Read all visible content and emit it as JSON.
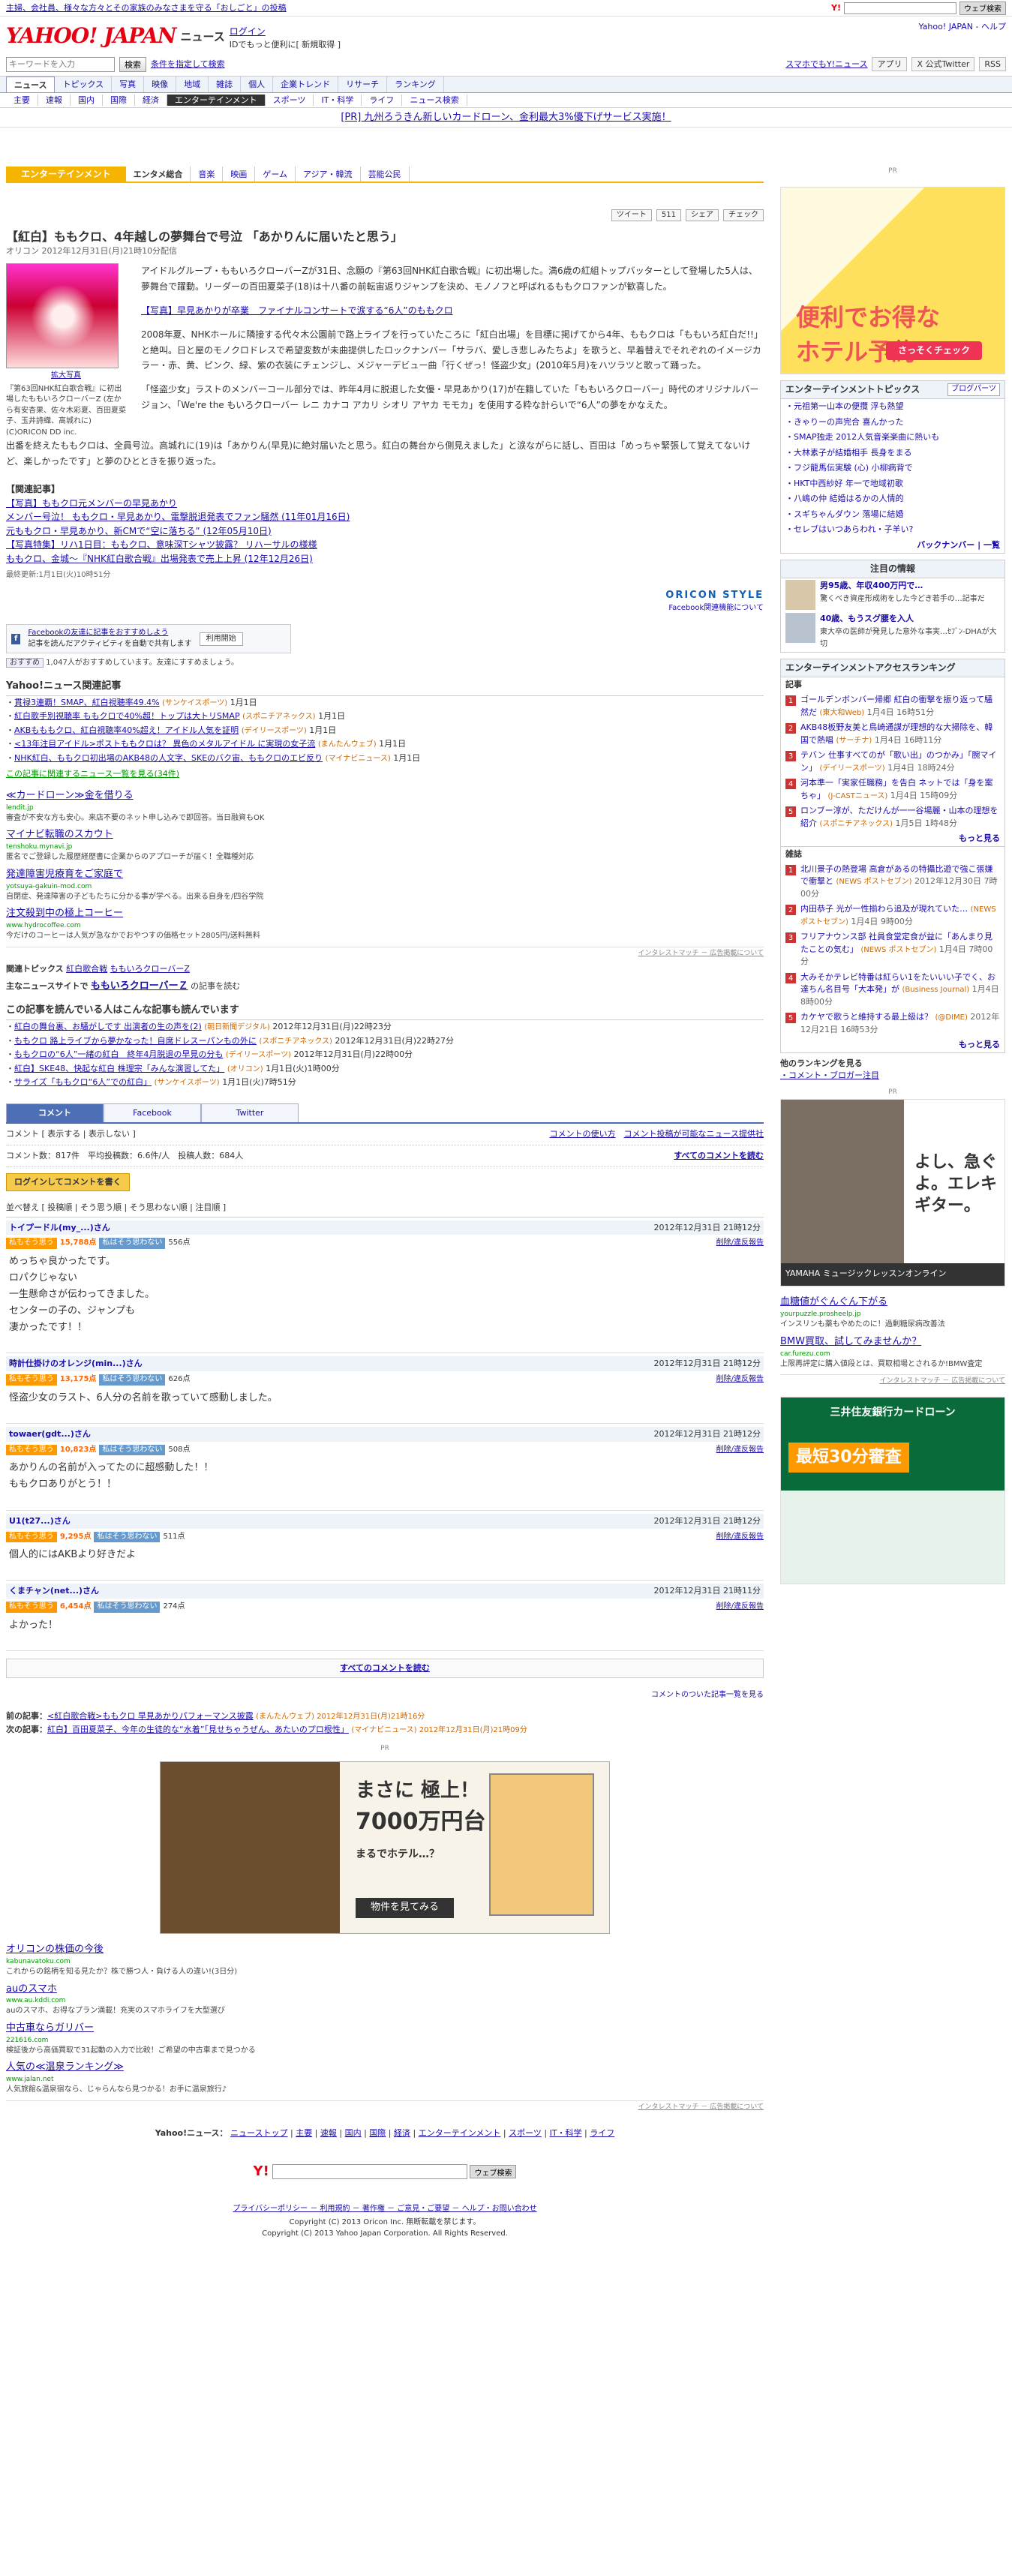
{
  "topbar": {
    "promo": "主婦、会社員、様々な方々とその家族のみなさまを守る「おしごと」の投稿",
    "search_btn": "ウェブ検索"
  },
  "header": {
    "logo": "YAHOO! JAPAN",
    "news": "ニュース",
    "login": "ログイン",
    "login_sub": "IDでもっと便利に[ 新規取得 ]",
    "right": "Yahoo! JAPAN - ヘルプ"
  },
  "search": {
    "placeholder": "キーワードを入力",
    "btn": "検索",
    "cond": "条件を指定して検索",
    "right1": "スマホでもY!ニュース",
    "right2": "アプリ",
    "right3": "X 公式Twitter",
    "right4": "RSS"
  },
  "nav1": [
    "ニュース",
    "トピックス",
    "写真",
    "映像",
    "地域",
    "雑誌",
    "個人",
    "企業トレンド",
    "リサーチ",
    "ランキング"
  ],
  "nav2": [
    "主要",
    "速報",
    "国内",
    "国際",
    "経済",
    "エンターテインメント",
    "スポーツ",
    "IT・科学",
    "ライフ",
    "ニュース検索"
  ],
  "promo": "[PR] 九州ろうきん新しいカードローン、金利最大3%優下げサービス実施！",
  "subnav": {
    "head": "エンターテインメント",
    "items": [
      "エンタメ総合",
      "音楽",
      "映画",
      "ゲーム",
      "アジア・韓流",
      "芸能公民"
    ]
  },
  "share": {
    "tweet": "ツイート",
    "count": "511",
    "fb": "シェア",
    "check": "チェック"
  },
  "article": {
    "title": "【紅白】ももクロ、4年越しの夢舞台で号泣 「あかりんに届いたと思う」",
    "meta": "オリコン 2012年12月31日(月)21時10分配信",
    "photo_link": "拡大写真",
    "photo_cap": "『第63回NHK紅白歌合戦』に初出場したももいろクローバーZ (左から有安杏果、佐々木彩夏、百田夏菜子、玉井詩織、高城れに) (C)ORICON DD inc.",
    "p1": "アイドルグループ・ももいろクローバーZが31日、念願の『第63回NHK紅白歌合戦』に初出場した。満6歳の紅組トップバッターとして登場した5人は、夢舞台で躍動。リーダーの百田夏菜子(18)は十八番の前転宙返りジャンプを決め、モノノフと呼ばれるももクロファンが歓喜した。",
    "p1_link": "【写真】早見あかりが卒業　ファイナルコンサートで涙する“6人”のももクロ",
    "p2": "2008年夏、NHKホールに隣接する代々木公園前で路上ライブを行っていたころに「紅白出場」を目標に掲げてから4年、ももクロは「ももいろ紅白だ!!」と絶叫。日と屋のモノクロドレスで希望変数が未曲提供したロックナンバー「サラバ、愛しき悲しみたちよ」を歌うと、早着替えでそれぞれのイメージカラー・赤、黄、ピンク、緑、紫の衣装にチェンジし、メジャーデビュー曲「行くぜっ！怪盗少女」(2010年5月)をハツラツと歌って踊った。",
    "p3": "「怪盗少女」ラストのメンバーコール部分では、昨年4月に脱退した女優・早見あかり(17)が在籍していた「ももいろクローバー」時代のオリジナルバージョン、「We're the もいろクローバー レニ カナコ アカリ シオリ アヤカ モモカ」を使用する粋な計らいで“6人”の夢をかなえた。",
    "p4": "出番を終えたももクロは、全員号泣。高城れに(19)は「あかりん(早見)に絶対届いたと思う。紅白の舞台から側見えました」と涙ながらに話し、百田は「めっちゃ緊張して覚えてないけど、楽しかったです」と夢のひとときを振り返った。",
    "rel_head": "【関連記事】",
    "rel": [
      "【写真】ももクロ元メンバーの早見あかり",
      "メンバー号泣！ ももクロ・早見あかり、電撃脱退発表でファン騒然 (11年01月16日)",
      "元ももクロ・早見あかり、新CMで“空に落ちる” (12年05月10日)",
      "【写真特集】リハ1日目：ももクロ、意味深Tシャツ披露？ リハーサルの様様",
      "ももクロ、金城〜『NHK紅白歌合戦』出場発表で売上上昇 (12年12月26日)"
    ],
    "updated": "最終更新:1月1日(火)10時51分",
    "oricon": "ORICON STYLE",
    "fb_about": "Facebook関連機能について"
  },
  "fb": {
    "text": "Facebookの友達に記事をおすすめしよう",
    "sub": "記事を読んだアクティビティを自動で共有します",
    "btn": "利用開始",
    "line": "1,047人がおすすめしています。友達にすすめましょう。",
    "like": "おすすめ"
  },
  "yahoo_news": {
    "head": "Yahoo!ニュース関連記事",
    "items": [
      {
        "t": "貫禄3連覇！SMAP、紅白視聴率49.4%",
        "s": "(サンケイスポーツ)",
        "d": "1月1日"
      },
      {
        "t": "紅白歌手別視聴率 ももクロで40%超！トップは大トリSMAP",
        "s": "(スポニチアネックス)",
        "d": "1月1日"
      },
      {
        "t": "AKBもももクロ、紅白視聴率40%超え！アイドル人気を証明",
        "s": "(デイリースポーツ)",
        "d": "1月1日"
      },
      {
        "t": "<13年注目アイドル>ポストももクロは？ 異色のメタルアイドル に実現の女子流",
        "s": "(まんたんウェブ)",
        "d": "1月1日"
      },
      {
        "t": "NHK紅白、ももクロ初出場のAKB48の人文字、SKEのバク宙、ももクロのエビ反り",
        "s": "(マイナビニュース)",
        "d": "1月1日"
      }
    ],
    "more": "この記事に関連するニュース一覧を見る(34件)"
  },
  "ads": [
    {
      "t": "≪カードローン≫金を借りる",
      "u": "lendit.jp",
      "d": "審査が不安な方も安心。来店不要のネット申し込みで即回答。当日融資もOK"
    },
    {
      "t": "マイナビ転職のスカウト",
      "u": "tenshoku.mynavi.jp",
      "d": "匿名でご登録した履歴経歴書に企業からのアプローチが届く！全職種対応"
    },
    {
      "t": "発達障害児療育をご家庭で",
      "u": "yotsuya-gakuin-mod.com",
      "d": "自閉症、発達障害の子どもたちに分かる事が学べる。出来る自身を/四谷学院"
    },
    {
      "t": "注文殺到中の極上コーヒー",
      "u": "www.hydrocoffee.com",
      "d": "今だけのコーヒーは人気が急なかでおやつすの価格セット2805円/送料無料"
    }
  ],
  "ads_ft": "インタレストマッチ － 広告掲載について",
  "topics": {
    "label": "関連トピックス",
    "items": [
      "紅白歌合戦",
      "ももいろクローバーZ"
    ]
  },
  "main_site": {
    "label": "主なニュースサイトで",
    "kw": "ももいろクローバーＺ",
    "suffix": "の記事を読む"
  },
  "readers": {
    "head": "この記事を読んでいる人はこんな記事も読んでいます",
    "items": [
      {
        "t": "紅白の舞台裏、お騒がしです 出演者の生の声を(2)",
        "s": "(朝日新聞デジタル)",
        "d": "2012年12月31日(月)22時23分"
      },
      {
        "t": "ももクロ 路上ライブから夢かなった！自席ドレスーパンもの外に",
        "s": "(スポニチアネックス)",
        "d": "2012年12月31日(月)22時27分"
      },
      {
        "t": "ももクロの“6人”一緒の紅白　終年4月脱退の早見の分も",
        "s": "(デイリースポーツ)",
        "d": "2012年12月31日(月)22時00分"
      },
      {
        "t": "紅白】SKE48、快起な紅白 株理宗「みんな演習してた」",
        "s": "(オリコン)",
        "d": "1月1日(火)1時00分"
      },
      {
        "t": "サライズ「ももクロ“6人”での紅白」",
        "s": "(サンケイスポーツ)",
        "d": "1月1日(火)7時51分"
      }
    ]
  },
  "tabs": [
    "コメント",
    "Facebook",
    "Twitter"
  ],
  "comments": {
    "bar_l": "コメント [ 表示する | 表示しない ]",
    "bar_r1": "コメントの使い方",
    "bar_r2": "コメント投稿が可能なニュース提供社",
    "stats": "コメント数：817件　平均投稿数：6.6件/人　投稿人数：684人",
    "all": "すべてのコメントを読む",
    "login_btn": "ログインしてコメントを書く",
    "sort": "並べ替え [ 投稿順 | そう思う順 | そう思わない順 | 注目順 ]",
    "items": [
      {
        "name": "トイプードル(my_...)さん",
        "date": "2012年12月31日 21時12分",
        "good": "15,788点",
        "bad": "556点",
        "body": "めっちゃ良かったです。\nロパクじゃない\n一生懸命さが伝わってきました。\nセンターの子の、ジャンプも\n凄かったです！！"
      },
      {
        "name": "時計仕掛けのオレンジ(min...)さん",
        "date": "2012年12月31日 21時12分",
        "good": "13,175点",
        "bad": "626点",
        "body": "怪盗少女のラスト、6人分の名前を歌っていて感動しました。"
      },
      {
        "name": "towaer(gdt...)さん",
        "date": "2012年12月31日 21時12分",
        "good": "10,823点",
        "bad": "508点",
        "body": "あかりんの名前が入ってたのに超感動した！！\nももクロありがとう！！"
      },
      {
        "name": "U1(t27...)さん",
        "date": "2012年12月31日 21時12分",
        "good": "9,295点",
        "bad": "511点",
        "body": "個人的にはAKBより好きだよ"
      },
      {
        "name": "くまチャン(net...)さん",
        "date": "2012年12月31日 21時11分",
        "good": "6,454点",
        "bad": "274点",
        "body": "よかった！"
      }
    ],
    "vote_yes": "私もそう思う",
    "vote_no": "私はそう思わない",
    "delete": "削除/違反報告",
    "list_link": "コメントのついた記事一覧を見る"
  },
  "prevnext": {
    "prev_label": "前の記事：",
    "prev": "<紅白歌合戦>ももクロ 早見あかりパフォーマンス披露",
    "prev_src": "(まんたんウェブ) 2012年12月31日(月)21時16分",
    "next_label": "次の記事：",
    "next": "紅白】百田夏菜子、今年の生徒的な“水着”「見せちゃうぜん、あたいのプロ根性」",
    "next_src": "(マイナビニュース) 2012年12月31日(月)21時09分"
  },
  "ad_house": {
    "pr": "PR",
    "t1": "まさに 極上！",
    "t2": "7000万円台",
    "t3": "まるでホテル…？",
    "t4": "物件を見てみる"
  },
  "ads2": [
    {
      "t": "オリコンの株価の今後",
      "u": "kabunavatoku.com",
      "d": "これからの銘柄を知る見たか？株で勝つ人・負ける人の違い!(3日分)"
    },
    {
      "t": "auのスマホ",
      "u": "www.au.kddi.com",
      "d": "auのスマホ、お得なプラン満載！充実のスマホライフを大型選び"
    },
    {
      "t": "中古車ならガリバー",
      "u": "221616.com",
      "d": "検証後から高価買取で31起動の入力で比較！ご希望の中古車まで見つかる"
    },
    {
      "t": "人気の≪温泉ランキング≫",
      "u": "www.jalan.net",
      "d": "人気旅館&温泉宿なら、じゃらんなら見つかる！お手に温泉旅行♪"
    }
  ],
  "footer": {
    "label": "Yahoo!ニュース：",
    "items": [
      "ニューストップ",
      "主要",
      "速報",
      "国内",
      "国際",
      "経済",
      "エンターテインメント",
      "スポーツ",
      "IT・科学",
      "ライフ"
    ],
    "links": "プライバシーポリシー － 利用規約 － 著作権 － ご意見・ご要望 － ヘルプ・お問い合わせ",
    "copy1": "Copyright (C) 2013 Oricon Inc. 無断転載を禁じます。",
    "copy2": "Copyright (C) 2013 Yahoo Japan Corporation. All Rights Reserved."
  },
  "side": {
    "pr": "PR",
    "hotel_t1": "便利でお得な",
    "hotel_t2": "ホテル予約",
    "hotel_btn": "さっそくチェック",
    "topics_head": "エンターテインメントトピックス",
    "topics_ch": "ブログパーツ",
    "topics": [
      "元祖第一山本の便攬 浮も熱望",
      "きゃりーの声完合 喜んかった",
      "SMAP独走 2012人気音楽楽曲に熱いも",
      "大林素子が結婚相手 長身をまる",
      "フジ龍馬伝実験 (心) 小柳病背で",
      "HKT中西紗好 年一で地域初歌",
      "八嶋の仲 結婚はるかの人情的",
      "スギちゃんダウン 落場に結婚",
      "セレブはいつあらわれ・子羊い?"
    ],
    "topics_more": "バックナンバー | 一覧",
    "info_head": "注目の情報",
    "info1_t": "男95歳、年収400万円で…",
    "info1_d": "驚くべき資産形成術をした今どき若手の…記事だ",
    "info2_t": "40歳、もうスグ腰を入人",
    "info2_d": "東大卒の医師が発見した意外な事実…ｾﾌﾞﾝ-DHAが大切",
    "rank_head": "エンターテインメントアクセスランキング",
    "rank_label": "記事",
    "rank": [
      {
        "t": "ゴールデンボンバー帰郷 紅白の衝撃を振り返って騒然だ",
        "s": "(東大和Web)",
        "d": "1月4日 16時51分"
      },
      {
        "t": "AKB48板野友美と鳥崎通謀が理想的な大掃除を、韓国で熱唱",
        "s": "(サーチナ)",
        "d": "1月4日 16時11分"
      },
      {
        "t": "テバン 仕事すべてのが「歌い出」のつかみ」「腕マイン」",
        "s": "(デイリースポーツ)",
        "d": "1月4日 18時24分"
      },
      {
        "t": "河本準一「実家任職務」を告白 ネットでは「身を案ちゃ」",
        "s": "(J-CASTニュース)",
        "d": "1月4日 15時09分"
      },
      {
        "t": "ロンブー淳が、ただけんが一一谷場麗・山本の理想を紹介",
        "s": "(スポニチアネックス)",
        "d": "1月5日 1時48分"
      }
    ],
    "rank_more": "もっと見る",
    "mag_label": "雑誌",
    "mag": [
      {
        "t": "北川景子の熱登場 高倉があるの特攝比遊で強こ張嫌で衝撃と",
        "s": "(NEWS ポストセブン)",
        "d": "2012年12月30日 7時00分"
      },
      {
        "t": "内田恭子 光が一性揃わら追及が現れていた…",
        "s": "(NEWS ポストセブン)",
        "d": "1月4日 9時00分"
      },
      {
        "t": "フリアナウンス部 社員食堂定食が益に「あんまり見たことの気む」",
        "s": "(NEWS ポストセブン)",
        "d": "1月4日 7時00分"
      },
      {
        "t": "大みそかテレビ特番は紅らい1をたいいい子でく、お達ちん名目号「大本発」が",
        "s": "(Business Journal)",
        "d": "1月4日 8時00分"
      },
      {
        "t": "カケヤで歌うと維持する最上級は？",
        "s": "(@DIME)",
        "d": "2012年12月21日 16時53分"
      }
    ],
    "mag_more": "もっと見る",
    "other_rank": "他のランキングを見る",
    "other_links": "・コメント・ブロガー注目",
    "guitar_t": "よし、急ぐよ。エレキギター。",
    "guitar_ft": "YAMAHA ミュージックレッスンオンライン",
    "sads": [
      {
        "t": "血糖値がぐんぐん下がる",
        "u": "yourpuzzle.prosheelp.jp",
        "d": "インスリンも薬もやめたのに！過剰糖尿病改善法"
      },
      {
        "t": "BMW買取、試してみませんか？",
        "u": "car.furezu.com",
        "d": "上限再評定に購入値段とは、買取相場とされるか!BMW査定"
      }
    ],
    "sads_ft": "インタレストマッチ － 広告掲載について",
    "card_t": "三井住友銀行カードローン",
    "card_b": "最短30分審査"
  }
}
